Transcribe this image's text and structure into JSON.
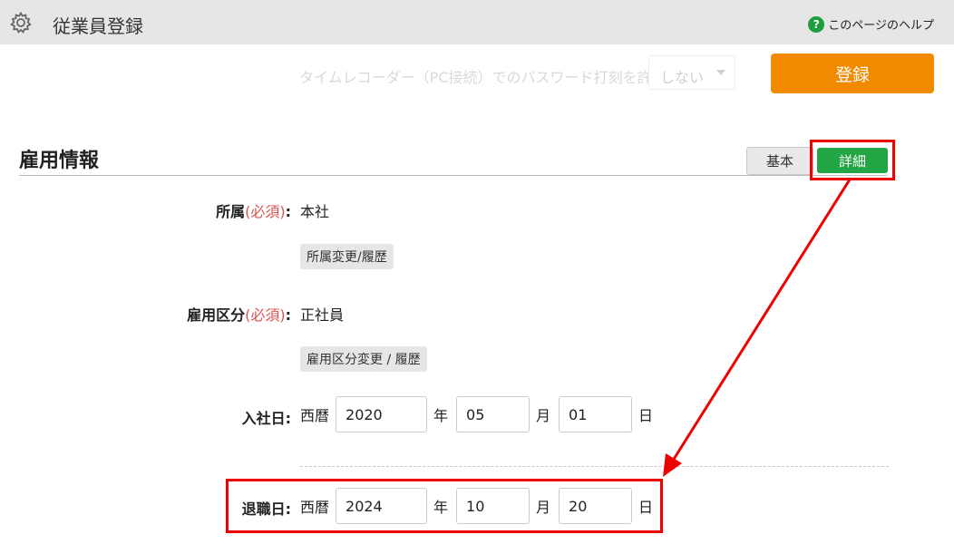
{
  "header": {
    "title": "従業員登録",
    "help_label": "このページのヘルプ",
    "help_icon_text": "?"
  },
  "timerecorder": {
    "label": "タイムレコーダー（PC接続）でのパスワード打刻を許可",
    "value": "しない"
  },
  "register_button": "登録",
  "section": {
    "title": "雇用情報",
    "tabs": [
      "基本",
      "詳細"
    ],
    "active_tab": "詳細"
  },
  "fields": {
    "affiliation": {
      "label": "所属",
      "required": "(必須)",
      "colon": ":",
      "value": "本社",
      "button": "所属変更/履歴"
    },
    "employment_type": {
      "label": "雇用区分",
      "required": "(必須)",
      "colon": ":",
      "value": "正社員",
      "button": "雇用区分変更 / 履歴"
    },
    "hire_date": {
      "label": "入社日:",
      "era": "西暦",
      "year": "2020",
      "month": "05",
      "day": "01"
    },
    "retire_date": {
      "label": "退職日:",
      "era": "西暦",
      "year": "2024",
      "month": "10",
      "day": "20"
    }
  },
  "units": {
    "year": "年",
    "month": "月",
    "day": "日"
  },
  "colors": {
    "accent_orange": "#f28a00",
    "active_tab_green": "#22a645",
    "highlight_red": "#ee0000",
    "required_red": "#e05050",
    "header_gray": "#e6e6e6"
  }
}
